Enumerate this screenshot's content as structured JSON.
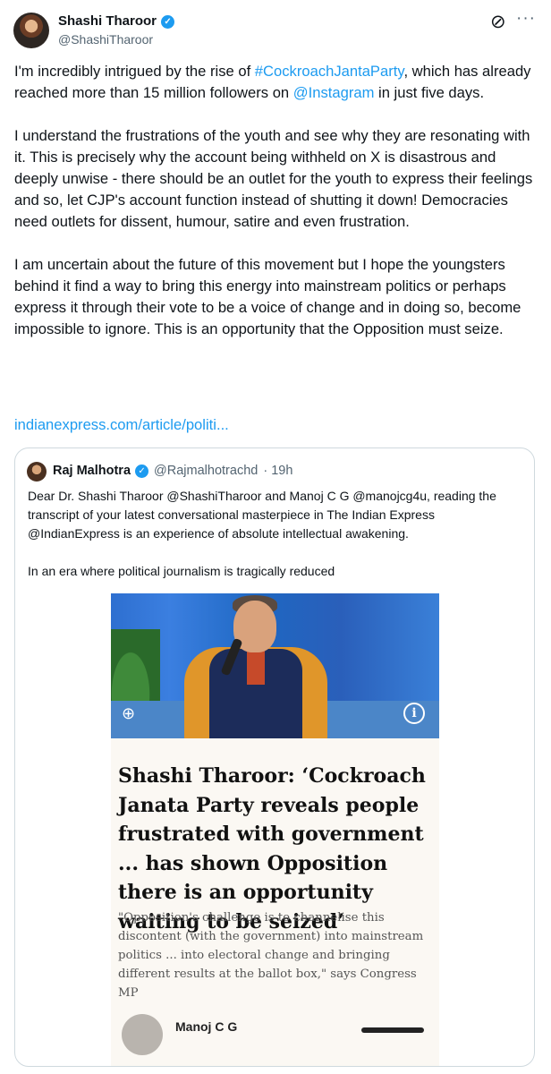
{
  "author": {
    "name": "Shashi Tharoor",
    "handle": "@ShashiTharoor"
  },
  "icons": {
    "verified": "verified-badge-icon",
    "grok": "grok-icon",
    "more": "more-icon"
  },
  "tweet": {
    "p1_a": "I'm incredibly intrigued by the rise of ",
    "p1_hashtag": "#CockroachJantaParty",
    "p1_b": ", which has already reached more than 15 million followers on ",
    "p1_mention": "@Instagram",
    "p1_c": " in just five days.",
    "p2": "I understand the frustrations of the youth and see why they are resonating with it. This is precisely why the account being withheld on X is disastrous and deeply unwise - there should be an outlet for the youth to express their feelings and so, let CJP's account function instead of shutting it down! Democracies need outlets for dissent, humour, satire and even frustration.",
    "p3": "I am uncertain about the future of this movement but I hope the youngsters behind it find a way to bring this energy into mainstream politics or perhaps express it through their vote to be a voice of change and in doing so, become impossible to ignore. This is an opportunity that the Opposition must seize.",
    "link": "indianexpress.com/article/politi..."
  },
  "quote": {
    "name": "Raj Malhotra",
    "handle": "@Rajmalhotrachd",
    "time": "· 19h",
    "p1": "Dear Dr. Shashi Tharoor @ShashiTharoor and Manoj C G @manojcg4u, reading the transcript of your latest conversational masterpiece in The Indian Express @IndianExpress is an experience of absolute intellectual awakening.",
    "p2": "In an era where political journalism is tragically reduced"
  },
  "article": {
    "headline": "Shashi Tharoor: ‘Cockroach Janata Party reveals people frustrated with government ... has shown Opposition there is an opportunity waiting to be seized’",
    "standfirst": "\"Opposition's challenge is to channelise this discontent (with the government) into mainstream politics ... into electoral change and bringing different results at the ballot box,\" says Congress MP",
    "byline": "Manoj C G",
    "info_glyph": "i",
    "zoom_glyph": "⊕"
  },
  "colors": {
    "link": "#1d9bf0",
    "secondary_text": "#536471",
    "border": "#cfd9de"
  }
}
